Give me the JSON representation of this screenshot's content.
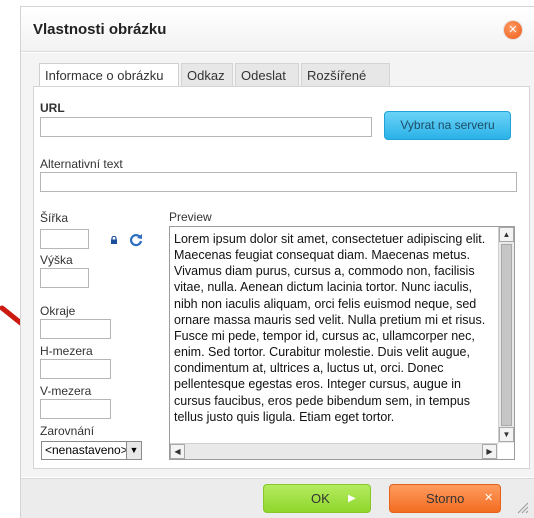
{
  "dialog": {
    "title": "Vlastnosti obrázku",
    "close_icon": "close-icon",
    "tabs": [
      {
        "label": "Informace o obrázku",
        "active": true
      },
      {
        "label": "Odkaz",
        "active": false
      },
      {
        "label": "Odeslat",
        "active": false
      },
      {
        "label": "Rozšířené",
        "active": false
      }
    ]
  },
  "form": {
    "url_label": "URL",
    "url_value": "",
    "browse_server_label": "Vybrat na serveru",
    "alt_label": "Alternativní text",
    "alt_value": "",
    "width_label": "Šířka",
    "width_value": "",
    "height_label": "Výška",
    "height_value": "",
    "border_label": "Okraje",
    "border_value": "",
    "hspace_label": "H-mezera",
    "hspace_value": "",
    "vspace_label": "V-mezera",
    "vspace_value": "",
    "align_label": "Zarovnání",
    "align_value": "<nenastaveno>",
    "preview_label": "Preview",
    "preview_text": "Lorem ipsum dolor sit amet, consectetuer adipiscing elit. Maecenas feugiat consequat diam. Maecenas metus. Vivamus diam purus, cursus a, commodo non, facilisis vitae, nulla. Aenean dictum lacinia tortor. Nunc iaculis, nibh non iaculis aliquam, orci felis euismod neque, sed ornare massa mauris sed velit. Nulla pretium mi et risus. Fusce mi pede, tempor id, cursus ac, ullamcorper nec, enim. Sed tortor. Curabitur molestie. Duis velit augue, condimentum at, ultrices a, luctus ut, orci. Donec pellentesque egestas eros. Integer cursus, augue in cursus faucibus, eros pede bibendum sem, in tempus tellus justo quis ligula. Etiam eget tortor."
  },
  "footer": {
    "ok_label": "OK",
    "cancel_label": "Storno"
  },
  "colors": {
    "accent_blue": "#2ab2e8",
    "ok_green": "#8fd62c",
    "cancel_orange": "#f26d21",
    "annotation_red": "#cc1a10"
  }
}
